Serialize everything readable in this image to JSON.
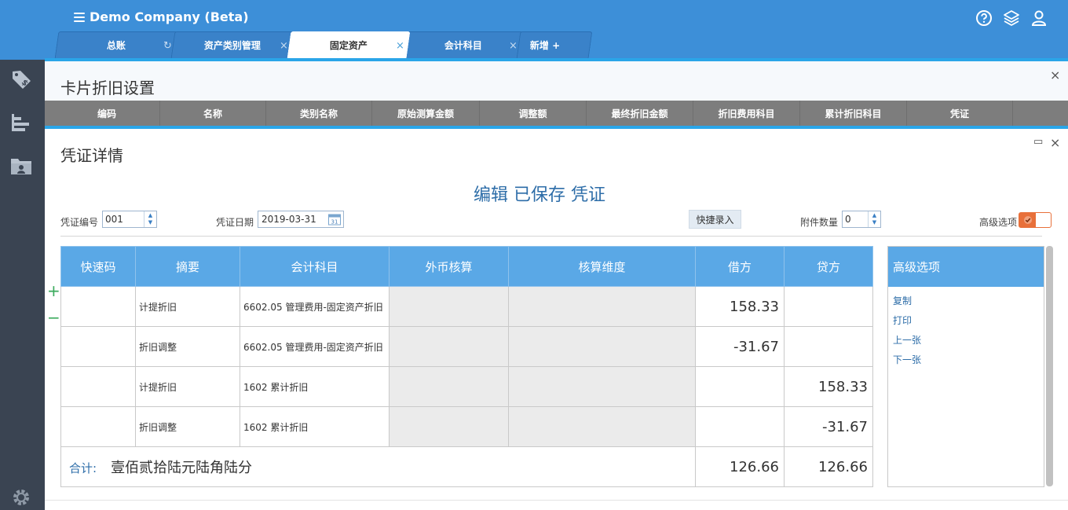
{
  "header": {
    "company": "Demo Company (Beta)",
    "icons": [
      "help-icon",
      "layers-icon",
      "user-icon"
    ]
  },
  "tabs": [
    {
      "label": "总账",
      "icon": "refresh-icon",
      "active": false
    },
    {
      "label": "资产类别管理",
      "icon": "close-icon",
      "active": false
    },
    {
      "label": "固定资产",
      "icon": "close-icon",
      "active": true
    },
    {
      "label": "会计科目",
      "icon": "close-icon",
      "active": false
    },
    {
      "label": "新增 +",
      "icon": "",
      "active": false
    }
  ],
  "sidebar": {
    "items": [
      "price-tag-icon",
      "report-icon",
      "contact-folder-icon",
      "gear-icon"
    ]
  },
  "panel_depreciation": {
    "title": "卡片折旧设置",
    "close": "×",
    "columns": [
      "编码",
      "名称",
      "类别名称",
      "原始测算金额",
      "调整额",
      "最终折旧金额",
      "折旧费用科目",
      "累计折旧科目",
      "凭证"
    ]
  },
  "panel_voucher": {
    "title": "凭证详情",
    "minimize": "▭",
    "close": "×",
    "heading": "编辑 已保存 凭证",
    "form": {
      "voucher_no_label": "凭证编号",
      "voucher_no": "001",
      "voucher_date_label": "凭证日期",
      "voucher_date": "2019-03-31",
      "calendar_day": "31",
      "quick_entry": "快捷录入",
      "attachments_label": "附件数量",
      "attachments": "0",
      "advanced_label": "高级选项"
    },
    "row_add": "+",
    "row_remove": "−",
    "table": {
      "headers": [
        "快速码",
        "摘要",
        "会计科目",
        "外币核算",
        "核算维度",
        "借方",
        "贷方"
      ],
      "rows": [
        {
          "code": "",
          "summary": "计提折旧",
          "account": "6602.05 管理费用-固定资产折旧",
          "fx": "",
          "dim": "",
          "debit": "158.33",
          "credit": ""
        },
        {
          "code": "",
          "summary": "折旧调整",
          "account": "6602.05 管理费用-固定资产折旧",
          "fx": "",
          "dim": "",
          "debit": "-31.67",
          "credit": ""
        },
        {
          "code": "",
          "summary": "计提折旧",
          "account": "1602 累计折旧",
          "fx": "",
          "dim": "",
          "debit": "",
          "credit": "158.33"
        },
        {
          "code": "",
          "summary": "折旧调整",
          "account": "1602 累计折旧",
          "fx": "",
          "dim": "",
          "debit": "",
          "credit": "-31.67"
        }
      ],
      "total_label": "合计:",
      "total_words": "壹佰贰拾陆元陆角陆分",
      "total_debit": "126.66",
      "total_credit": "126.66"
    },
    "advanced": {
      "title": "高级选项",
      "links": [
        "复制",
        "打印",
        "上一张",
        "下一张"
      ]
    }
  },
  "colors": {
    "topbar": "#3d8fd8",
    "sidebar": "#3a4452",
    "table_header": "#5aa8e6",
    "accent": "#2aa5e8",
    "toggle": "#e8703a"
  }
}
